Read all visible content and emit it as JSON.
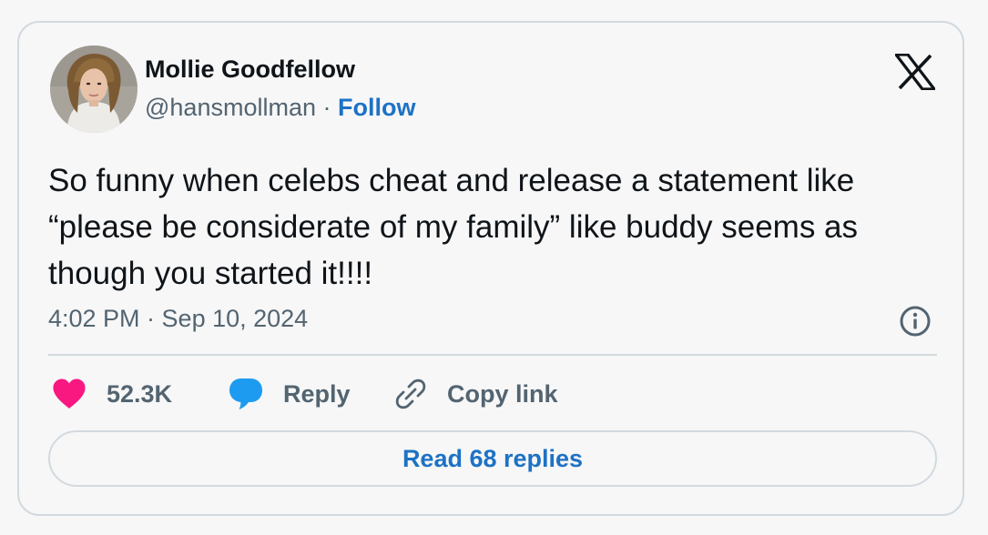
{
  "author": {
    "display_name": "Mollie Goodfellow",
    "handle": "@hansmollman",
    "separator": " · ",
    "follow_label": "Follow",
    "avatar_icon": "user-photo-avatar"
  },
  "platform": {
    "logo_icon": "x-logo-icon"
  },
  "tweet": {
    "text": "So funny when celebs cheat and release a statement like “please be considerate of my family” like buddy seems as though you started it!!!!",
    "timestamp": "4:02 PM · Sep 10, 2024"
  },
  "actions": {
    "like_count": "52.3K",
    "reply_label": "Reply",
    "copy_link_label": "Copy link",
    "read_replies_label": "Read 68 replies"
  },
  "colors": {
    "background": "#f7f7f7",
    "border": "#d2d9df",
    "text_primary": "#0f1419",
    "text_secondary": "#536471",
    "link_blue": "#1d72c4",
    "heart_pink": "#f91880",
    "reply_blue": "#1d9bf0"
  }
}
